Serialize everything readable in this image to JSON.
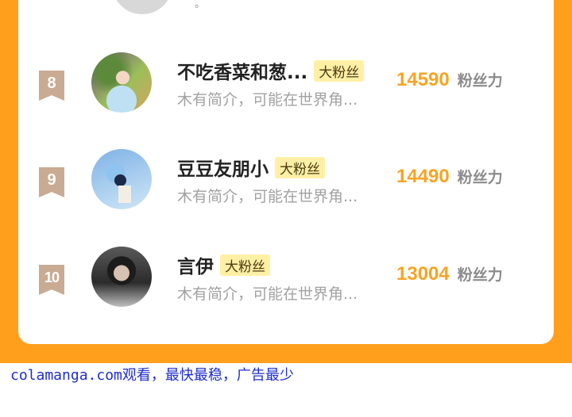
{
  "top_partial": {
    "text": "。"
  },
  "rows": [
    {
      "rank": "8",
      "name": "不吃香菜和葱...",
      "badge": "大粉丝",
      "bio": "木有简介，可能在世界角...",
      "score": "14590",
      "score_label": "粉丝力"
    },
    {
      "rank": "9",
      "name": "豆豆友朋小",
      "badge": "大粉丝",
      "bio": "木有简介，可能在世界角...",
      "score": "14490",
      "score_label": "粉丝力"
    },
    {
      "rank": "10",
      "name": "言伊",
      "badge": "大粉丝",
      "bio": "木有简介，可能在世界角...",
      "score": "13004",
      "score_label": "粉丝力"
    }
  ],
  "footer": {
    "text": "colamanga.com观看，最快最稳，广告最少"
  },
  "colors": {
    "frame": "#ff9f1c",
    "score": "#f6a423",
    "badge_bg": "#fff0a6",
    "rank_badge": "#c9ab93",
    "footer_link": "#1f2ec9"
  }
}
